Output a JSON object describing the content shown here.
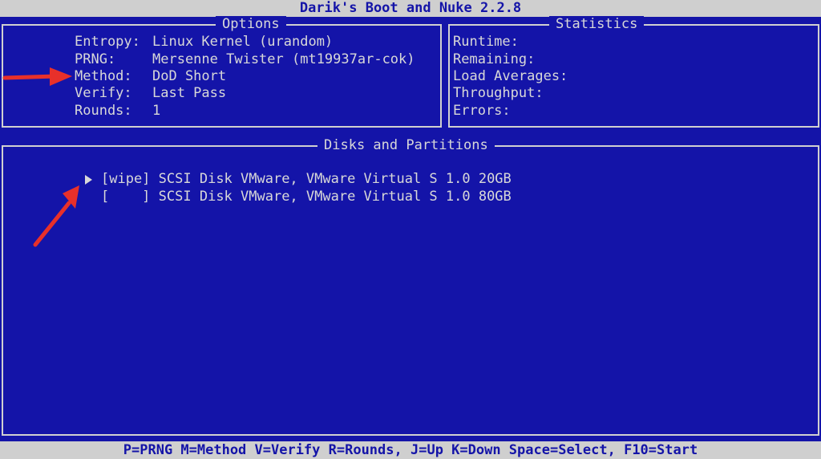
{
  "app_title": "Darik's Boot and Nuke 2.2.8",
  "options": {
    "title": "Options",
    "items": [
      {
        "label": "Entropy:",
        "value": "Linux Kernel (urandom)"
      },
      {
        "label": "PRNG:",
        "value": "Mersenne Twister (mt19937ar-cok)"
      },
      {
        "label": "Method:",
        "value": "DoD Short"
      },
      {
        "label": "Verify:",
        "value": "Last Pass"
      },
      {
        "label": "Rounds:",
        "value": "1"
      }
    ]
  },
  "statistics": {
    "title": "Statistics",
    "items": [
      {
        "label": "Runtime:"
      },
      {
        "label": "Remaining:"
      },
      {
        "label": "Load Averages:"
      },
      {
        "label": "Throughput:"
      },
      {
        "label": "Errors:"
      }
    ]
  },
  "disks": {
    "title": "Disks and Partitions",
    "items": [
      {
        "marker": "[wipe]",
        "name": "SCSI Disk VMware, VMware Virtual S 1.0 20GB",
        "selected": true
      },
      {
        "marker": "[    ]",
        "name": "SCSI Disk VMware, VMware Virtual S 1.0 80GB",
        "selected": false
      }
    ]
  },
  "footer": {
    "help": "P=PRNG M=Method V=Verify R=Rounds, J=Up K=Down Space=Select, F10=Start"
  },
  "colors": {
    "background": "#1414a8",
    "bar": "#cfcfcf",
    "text": "#d8d8d8",
    "annotation_arrow": "#e8302a"
  },
  "icons": {
    "selection_pointer": "triangle-right-icon",
    "annotation": "red-arrow-icon"
  }
}
